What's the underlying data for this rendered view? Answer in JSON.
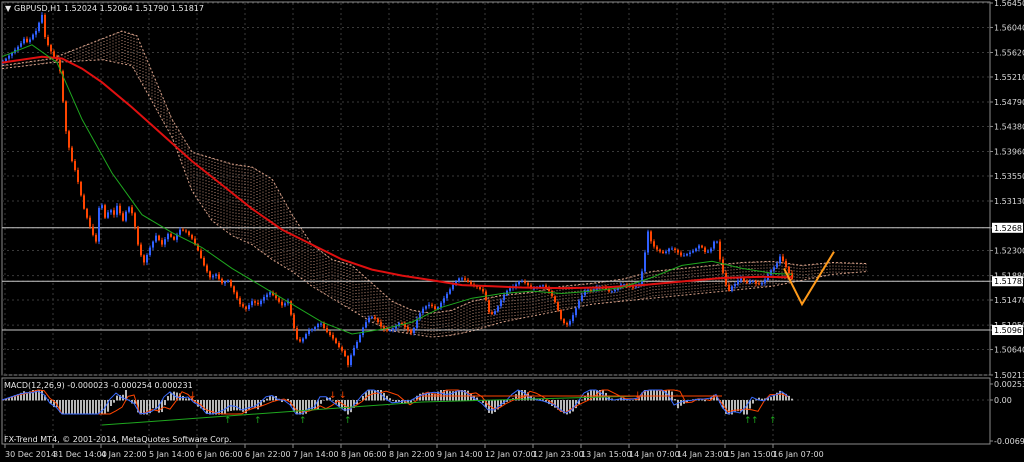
{
  "header": {
    "symbol": "GBPUSD,H1",
    "ohlc": "1.52024 1.52064 1.51790 1.51817"
  },
  "indicator": {
    "label": "MACD(12,26,9) -0.000023 -0.000254 0.000231",
    "axis_ticks": [
      "0.002535",
      "0.00",
      "-0.006955"
    ]
  },
  "watermark": "FX-Trend MT4, © 2001-2014, MetaQuotes Software Corp.",
  "colors": {
    "background": "#000000",
    "grid": "#3a3a3a",
    "bull": "#3060ff",
    "bear": "#ff4500",
    "ma_slow": "#e01010",
    "ma_fast": "#1fa81f",
    "cloud": "#d9a28a",
    "level_line": "#c8c8c8",
    "projection": "#ff9a1a"
  },
  "chart_data": {
    "type": "candlestick",
    "ylim": [
      1.50213,
      1.5645
    ],
    "y_ticks": [
      "1.56450",
      "1.56040",
      "1.55620",
      "1.55210",
      "1.54790",
      "1.54380",
      "1.53960",
      "1.53550",
      "1.53130",
      "1.52681",
      "1.52300",
      "1.51880",
      "1.51785",
      "1.51470",
      "1.51050",
      "1.50967",
      "1.50640",
      "1.50213"
    ],
    "x_ticks": [
      "30 Dec 2014",
      "31 Dec 14:00",
      "4 Jan 22:00",
      "5 Jan 14:00",
      "6 Jan 06:00",
      "6 Jan 22:00",
      "7 Jan 14:00",
      "8 Jan 06:00",
      "8 Jan 22:00",
      "9 Jan 14:00",
      "12 Jan 07:00",
      "12 Jan 23:00",
      "13 Jan 15:00",
      "14 Jan 07:00",
      "14 Jan 23:00",
      "15 Jan 15:00",
      "16 Jan 07:00"
    ],
    "levels": [
      1.52681,
      1.51785,
      1.50967
    ],
    "close_path": [
      [
        0,
        1.5545
      ],
      [
        6,
        1.5555
      ],
      [
        12,
        1.5565
      ],
      [
        18,
        1.5575
      ],
      [
        22,
        1.5585
      ],
      [
        26,
        1.5578
      ],
      [
        30,
        1.559
      ],
      [
        34,
        1.5598
      ],
      [
        37,
        1.5612
      ],
      [
        40,
        1.5625
      ],
      [
        43,
        1.5588
      ],
      [
        47,
        1.557
      ],
      [
        52,
        1.5555
      ],
      [
        57,
        1.5546
      ],
      [
        60,
        1.55
      ],
      [
        63,
        1.544
      ],
      [
        66,
        1.541
      ],
      [
        70,
        1.538
      ],
      [
        74,
        1.536
      ],
      [
        78,
        1.533
      ],
      [
        82,
        1.53
      ],
      [
        86,
        1.528
      ],
      [
        90,
        1.526
      ],
      [
        94,
        1.5245
      ],
      [
        98,
        1.532
      ],
      [
        103,
        1.5285
      ],
      [
        108,
        1.53
      ],
      [
        112,
        1.529
      ],
      [
        116,
        1.531
      ],
      [
        120,
        1.5275
      ],
      [
        124,
        1.5295
      ],
      [
        128,
        1.5305
      ],
      [
        132,
        1.528
      ],
      [
        137,
        1.523
      ],
      [
        142,
        1.521
      ],
      [
        148,
        1.5235
      ],
      [
        154,
        1.5255
      ],
      [
        160,
        1.524
      ],
      [
        166,
        1.5258
      ],
      [
        172,
        1.5248
      ],
      [
        178,
        1.5265
      ],
      [
        184,
        1.5262
      ],
      [
        190,
        1.525
      ],
      [
        196,
        1.523
      ],
      [
        202,
        1.5205
      ],
      [
        208,
        1.5185
      ],
      [
        214,
        1.519
      ],
      [
        220,
        1.5175
      ],
      [
        226,
        1.518
      ],
      [
        232,
        1.516
      ],
      [
        238,
        1.514
      ],
      [
        244,
        1.5132
      ],
      [
        250,
        1.5145
      ],
      [
        256,
        1.514
      ],
      [
        262,
        1.5152
      ],
      [
        268,
        1.516
      ],
      [
        274,
        1.515
      ],
      [
        280,
        1.5138
      ],
      [
        286,
        1.5145
      ],
      [
        292,
        1.51
      ],
      [
        296,
        1.5075
      ],
      [
        300,
        1.508
      ],
      [
        306,
        1.5095
      ],
      [
        312,
        1.51
      ],
      [
        318,
        1.511
      ],
      [
        324,
        1.5095
      ],
      [
        330,
        1.5085
      ],
      [
        336,
        1.507
      ],
      [
        342,
        1.5058
      ],
      [
        346,
        1.5038
      ],
      [
        350,
        1.506
      ],
      [
        356,
        1.508
      ],
      [
        362,
        1.5105
      ],
      [
        368,
        1.512
      ],
      [
        374,
        1.5115
      ],
      [
        380,
        1.51
      ],
      [
        386,
        1.5095
      ],
      [
        392,
        1.51
      ],
      [
        398,
        1.511
      ],
      [
        404,
        1.51
      ],
      [
        410,
        1.509
      ],
      [
        416,
        1.512
      ],
      [
        422,
        1.5135
      ],
      [
        428,
        1.514
      ],
      [
        434,
        1.513
      ],
      [
        440,
        1.5145
      ],
      [
        446,
        1.516
      ],
      [
        452,
        1.5175
      ],
      [
        458,
        1.5185
      ],
      [
        464,
        1.518
      ],
      [
        470,
        1.5172
      ],
      [
        476,
        1.5168
      ],
      [
        482,
        1.516
      ],
      [
        488,
        1.512
      ],
      [
        494,
        1.513
      ],
      [
        500,
        1.515
      ],
      [
        506,
        1.5165
      ],
      [
        512,
        1.517
      ],
      [
        518,
        1.518
      ],
      [
        524,
        1.5175
      ],
      [
        530,
        1.5165
      ],
      [
        536,
        1.517
      ],
      [
        542,
        1.5172
      ],
      [
        548,
        1.516
      ],
      [
        554,
        1.514
      ],
      [
        560,
        1.511
      ],
      [
        566,
        1.5105
      ],
      [
        572,
        1.5125
      ],
      [
        578,
        1.515
      ],
      [
        584,
        1.5165
      ],
      [
        590,
        1.5162
      ],
      [
        596,
        1.517
      ],
      [
        602,
        1.5168
      ],
      [
        608,
        1.516
      ],
      [
        614,
        1.5165
      ],
      [
        620,
        1.5175
      ],
      [
        626,
        1.517
      ],
      [
        632,
        1.5168
      ],
      [
        638,
        1.5175
      ],
      [
        642,
        1.5215
      ],
      [
        646,
        1.5262
      ],
      [
        650,
        1.524
      ],
      [
        656,
        1.523
      ],
      [
        662,
        1.5225
      ],
      [
        668,
        1.5235
      ],
      [
        674,
        1.523
      ],
      [
        680,
        1.522
      ],
      [
        686,
        1.5225
      ],
      [
        692,
        1.523
      ],
      [
        698,
        1.524
      ],
      [
        704,
        1.5225
      ],
      [
        710,
        1.5235
      ],
      [
        714,
        1.5255
      ],
      [
        718,
        1.5215
      ],
      [
        722,
        1.5185
      ],
      [
        726,
        1.516
      ],
      [
        730,
        1.517
      ],
      [
        734,
        1.5175
      ],
      [
        738,
        1.5185
      ],
      [
        744,
        1.5175
      ],
      [
        750,
        1.518
      ],
      [
        756,
        1.5172
      ],
      [
        762,
        1.5178
      ],
      [
        768,
        1.5195
      ],
      [
        774,
        1.5205
      ],
      [
        778,
        1.522
      ],
      [
        782,
        1.521
      ],
      [
        786,
        1.5195
      ],
      [
        790,
        1.5182
      ]
    ],
    "ma_slow": [
      [
        0,
        1.5545
      ],
      [
        40,
        1.5555
      ],
      [
        60,
        1.5552
      ],
      [
        80,
        1.5535
      ],
      [
        100,
        1.5512
      ],
      [
        130,
        1.547
      ],
      [
        160,
        1.5425
      ],
      [
        190,
        1.538
      ],
      [
        220,
        1.534
      ],
      [
        250,
        1.53
      ],
      [
        280,
        1.5265
      ],
      [
        310,
        1.524
      ],
      [
        340,
        1.5215
      ],
      [
        370,
        1.5198
      ],
      [
        400,
        1.5188
      ],
      [
        430,
        1.518
      ],
      [
        460,
        1.5172
      ],
      [
        490,
        1.517
      ],
      [
        520,
        1.5168
      ],
      [
        560,
        1.5167
      ],
      [
        600,
        1.5168
      ],
      [
        640,
        1.5172
      ],
      [
        680,
        1.5178
      ],
      [
        720,
        1.5184
      ],
      [
        760,
        1.5186
      ],
      [
        790,
        1.5185
      ]
    ],
    "ma_fast": [
      [
        0,
        1.5555
      ],
      [
        30,
        1.5575
      ],
      [
        55,
        1.5545
      ],
      [
        80,
        1.545
      ],
      [
        110,
        1.536
      ],
      [
        140,
        1.529
      ],
      [
        170,
        1.526
      ],
      [
        200,
        1.5235
      ],
      [
        230,
        1.52
      ],
      [
        260,
        1.517
      ],
      [
        290,
        1.514
      ],
      [
        320,
        1.511
      ],
      [
        350,
        1.509
      ],
      [
        380,
        1.5098
      ],
      [
        410,
        1.511
      ],
      [
        440,
        1.5135
      ],
      [
        470,
        1.515
      ],
      [
        500,
        1.5158
      ],
      [
        530,
        1.5162
      ],
      [
        560,
        1.5158
      ],
      [
        590,
        1.5162
      ],
      [
        620,
        1.5168
      ],
      [
        650,
        1.5185
      ],
      [
        680,
        1.5205
      ],
      [
        710,
        1.5212
      ],
      [
        740,
        1.52
      ],
      [
        770,
        1.5192
      ],
      [
        790,
        1.519
      ]
    ],
    "cloud_a": [
      [
        0,
        1.554
      ],
      [
        50,
        1.5552
      ],
      [
        100,
        1.5585
      ],
      [
        120,
        1.5598
      ],
      [
        135,
        1.559
      ],
      [
        150,
        1.553
      ],
      [
        170,
        1.545
      ],
      [
        190,
        1.5395
      ],
      [
        210,
        1.5385
      ],
      [
        230,
        1.5375
      ],
      [
        250,
        1.537
      ],
      [
        270,
        1.535
      ],
      [
        290,
        1.529
      ],
      [
        310,
        1.524
      ],
      [
        330,
        1.5215
      ],
      [
        350,
        1.5205
      ],
      [
        370,
        1.5175
      ],
      [
        390,
        1.5145
      ],
      [
        410,
        1.513
      ],
      [
        430,
        1.5125
      ],
      [
        450,
        1.513
      ],
      [
        470,
        1.5145
      ],
      [
        500,
        1.5155
      ],
      [
        530,
        1.516
      ],
      [
        560,
        1.517
      ],
      [
        590,
        1.5175
      ],
      [
        620,
        1.5182
      ],
      [
        650,
        1.5195
      ],
      [
        680,
        1.52
      ],
      [
        710,
        1.5205
      ],
      [
        740,
        1.521
      ],
      [
        770,
        1.5212
      ],
      [
        800,
        1.5205
      ],
      [
        830,
        1.521
      ],
      [
        866,
        1.5208
      ]
    ],
    "cloud_b": [
      [
        0,
        1.5535
      ],
      [
        50,
        1.5545
      ],
      [
        100,
        1.555
      ],
      [
        130,
        1.554
      ],
      [
        150,
        1.548
      ],
      [
        170,
        1.542
      ],
      [
        190,
        1.533
      ],
      [
        210,
        1.528
      ],
      [
        230,
        1.5255
      ],
      [
        250,
        1.524
      ],
      [
        270,
        1.5215
      ],
      [
        290,
        1.5195
      ],
      [
        310,
        1.517
      ],
      [
        330,
        1.515
      ],
      [
        350,
        1.513
      ],
      [
        370,
        1.511
      ],
      [
        390,
        1.5095
      ],
      [
        410,
        1.509
      ],
      [
        430,
        1.5085
      ],
      [
        450,
        1.5088
      ],
      [
        470,
        1.5095
      ],
      [
        500,
        1.511
      ],
      [
        530,
        1.512
      ],
      [
        560,
        1.513
      ],
      [
        590,
        1.514
      ],
      [
        620,
        1.5145
      ],
      [
        650,
        1.515
      ],
      [
        680,
        1.5155
      ],
      [
        710,
        1.516
      ],
      [
        740,
        1.5165
      ],
      [
        770,
        1.517
      ],
      [
        800,
        1.518
      ],
      [
        830,
        1.519
      ],
      [
        866,
        1.5195
      ]
    ],
    "projection": [
      [
        782,
        1.52
      ],
      [
        800,
        1.514
      ],
      [
        832,
        1.5228
      ]
    ],
    "macd_label": "MACD(12,26,9)"
  }
}
